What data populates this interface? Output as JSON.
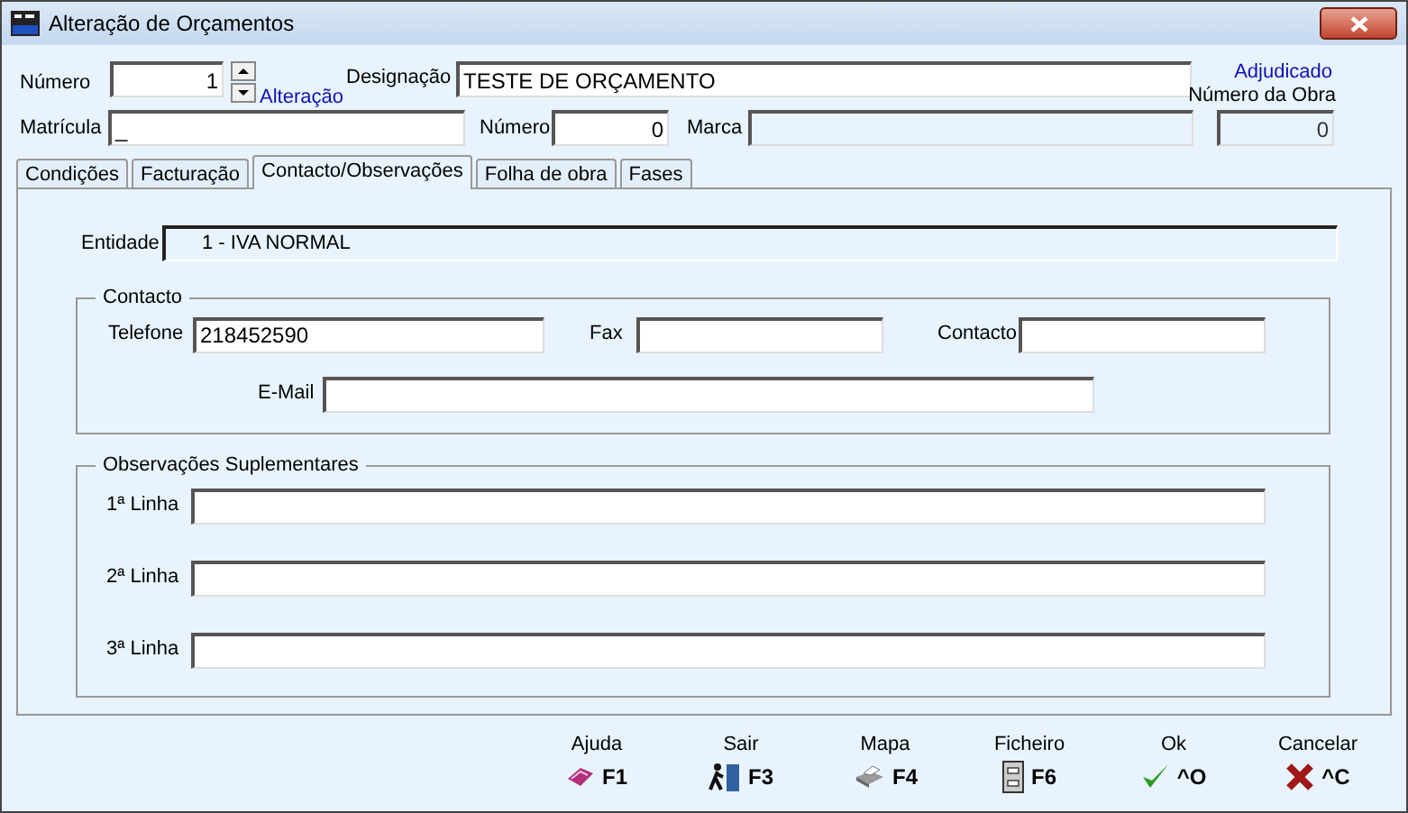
{
  "window": {
    "title": "Alteração de Orçamentos"
  },
  "header": {
    "numero": {
      "label": "Número",
      "value": "1"
    },
    "alteracao": "Alteração",
    "designacao": {
      "label": "Designação",
      "value": "TESTE DE ORÇAMENTO"
    },
    "adjudicado": "Adjudicado",
    "numero_obra": {
      "label": "Número da Obra",
      "value": "0",
      "disabled": true
    },
    "matricula": {
      "label": "Matrícula",
      "value": "_"
    },
    "numero2": {
      "label": "Número",
      "value": "0"
    },
    "marca": {
      "label": "Marca",
      "disabled": true
    }
  },
  "tabs": [
    {
      "label": "Condições",
      "selected": false
    },
    {
      "label": "Facturação",
      "selected": false
    },
    {
      "label": "Contacto/Observações",
      "selected": true
    },
    {
      "label": "Folha de obra",
      "selected": false
    },
    {
      "label": "Fases",
      "selected": false
    }
  ],
  "entidade": {
    "label": "Entidade",
    "value": "1 - IVA NORMAL",
    "disabled": true
  },
  "contacto": {
    "title": "Contacto",
    "telefone": {
      "label": "Telefone",
      "value": "218452590"
    },
    "fax": {
      "label": "Fax"
    },
    "contacto": {
      "label": "Contacto"
    },
    "email": {
      "label": "E-Mail"
    }
  },
  "observacoes": {
    "title": "Observações Suplementares",
    "lines": [
      {
        "label": "1ª Linha"
      },
      {
        "label": "2ª Linha"
      },
      {
        "label": "3ª Linha"
      }
    ]
  },
  "buttons": [
    {
      "label": "Ajuda",
      "key": "F1",
      "kind": "help"
    },
    {
      "label": "Sair",
      "key": "F3",
      "kind": "exit"
    },
    {
      "label": "Mapa",
      "key": "F4",
      "kind": "print"
    },
    {
      "label": "Ficheiro",
      "key": "F6",
      "kind": "file"
    },
    {
      "label": "Ok",
      "key": "^O",
      "kind": "ok"
    },
    {
      "label": "Cancelar",
      "key": "^C",
      "kind": "cancel"
    }
  ]
}
